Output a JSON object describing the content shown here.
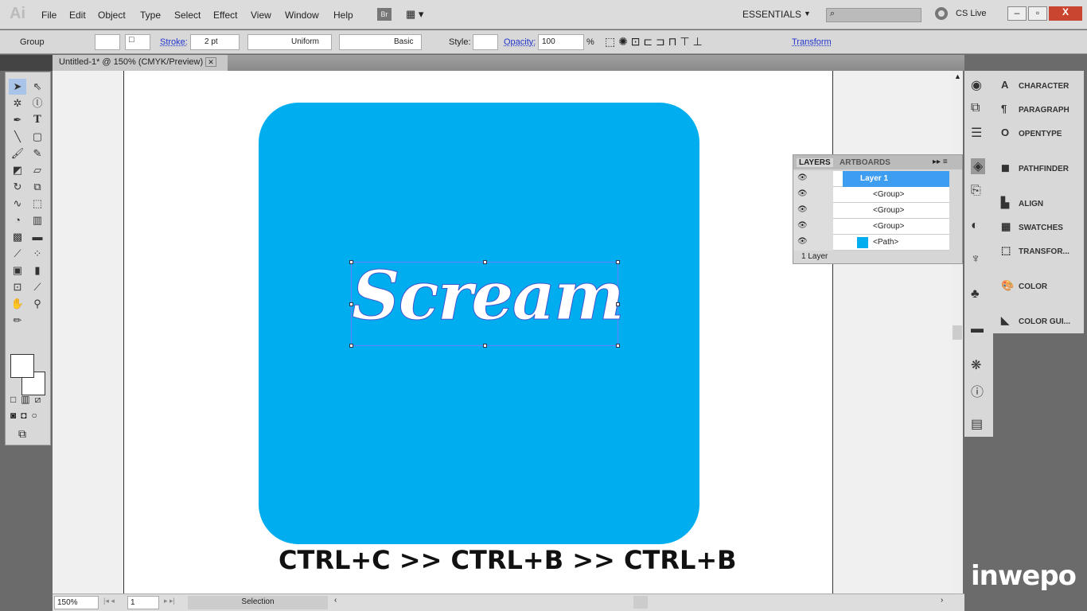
{
  "app": {
    "logo": "Ai",
    "menu": [
      "File",
      "Edit",
      "Object",
      "Type",
      "Select",
      "Effect",
      "View",
      "Window",
      "Help"
    ],
    "bridge": "Br",
    "workspace": "ESSENTIALS",
    "cslive": "CS Live"
  },
  "control": {
    "selection": "Group",
    "stroke_label": "Stroke:",
    "stroke_value": "2 pt",
    "profile": "Uniform",
    "brush": "Basic",
    "style_label": "Style:",
    "opacity_label": "Opacity:",
    "opacity_value": "100",
    "percent": "%",
    "transform": "Transform"
  },
  "document": {
    "tab": "Untitled-1* @ 150% (CMYK/Preview)",
    "art_text": "Scream",
    "caption": "CTRL+C >> CTRL+B >> CTRL+B",
    "fill_color": "#00aeef"
  },
  "layers": {
    "tabs": [
      "LAYERS",
      "ARTBOARDS"
    ],
    "rows": [
      "Layer 1",
      "<Group>",
      "<Group>",
      "<Group>",
      "<Path>"
    ],
    "footer": "1 Layer"
  },
  "dock": {
    "panels": [
      "CHARACTER",
      "PARAGRAPH",
      "OPENTYPE",
      "PATHFINDER",
      "ALIGN",
      "SWATCHES",
      "TRANSFOR...",
      "COLOR",
      "COLOR GUI..."
    ]
  },
  "status": {
    "zoom": "150%",
    "artboard": "1",
    "tool": "Selection"
  },
  "watermark": "inwepo"
}
